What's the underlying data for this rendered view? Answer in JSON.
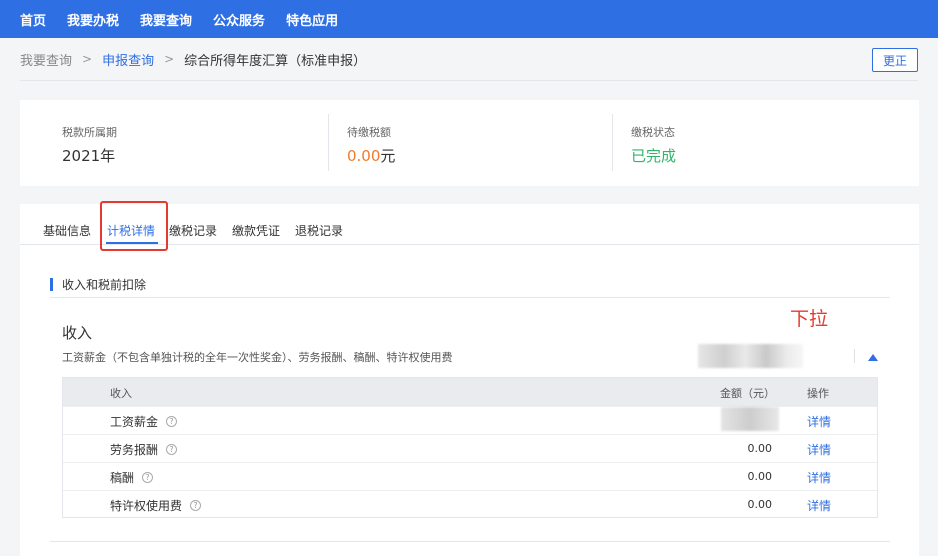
{
  "topnav": {
    "items": [
      "首页",
      "我要办税",
      "我要查询",
      "公众服务",
      "特色应用"
    ]
  },
  "breadcrumb": {
    "items": [
      "我要查询",
      "申报查询",
      "综合所得年度汇算（标准申报）"
    ],
    "separator": ">"
  },
  "actions": {
    "correct_label": "更正"
  },
  "summary": {
    "period": {
      "label": "税款所属期",
      "value": "2021年"
    },
    "tax_due": {
      "label": "待缴税额",
      "amount": "0.00",
      "unit": "元"
    },
    "status": {
      "label": "缴税状态",
      "value": "已完成"
    }
  },
  "tabs": [
    "基础信息",
    "计税详情",
    "缴税记录",
    "缴款凭证",
    "退税记录"
  ],
  "active_tab": "计税详情",
  "section": {
    "title": "收入和税前扣除"
  },
  "annotation": {
    "text": "下拉"
  },
  "income": {
    "title": "收入",
    "description": "工资薪金（不包含单独计税的全年一次性奖金）、劳务报酬、稿酬、特许权使用费",
    "table": {
      "headers": [
        "收入",
        "金额（元）",
        "操作"
      ],
      "rows": [
        {
          "name": "工资薪金",
          "amount": "",
          "action": "详情"
        },
        {
          "name": "劳务报酬",
          "amount": "0.00",
          "action": "详情"
        },
        {
          "name": "稿酬",
          "amount": "0.00",
          "action": "详情"
        },
        {
          "name": "特许权使用费",
          "amount": "0.00",
          "action": "详情"
        }
      ]
    }
  },
  "icons": {
    "help": "?",
    "collapse": "triangle-up",
    "breadcrumb_separator": "chevron-right"
  },
  "colors": {
    "brand": "#2f6fe4",
    "due_amount": "#f07b2a",
    "status_done": "#2fb56a",
    "annotation": "#e53a2f"
  }
}
